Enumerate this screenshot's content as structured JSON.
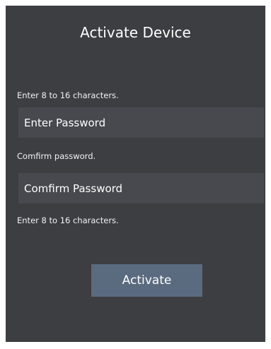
{
  "dialog": {
    "title": "Activate Device",
    "password_hint": "Enter 8 to 16 characters.",
    "password_placeholder": "Enter Password",
    "confirm_hint": "Comfirm password.",
    "confirm_placeholder": "Comfirm Password",
    "confirm_length_hint": "Enter 8 to 16 characters.",
    "activate_label": "Activate"
  },
  "colors": {
    "dialog_background": "#3d3e42",
    "field_background": "#48494f",
    "button_background": "#5a6b80",
    "text": "#ffffff"
  }
}
